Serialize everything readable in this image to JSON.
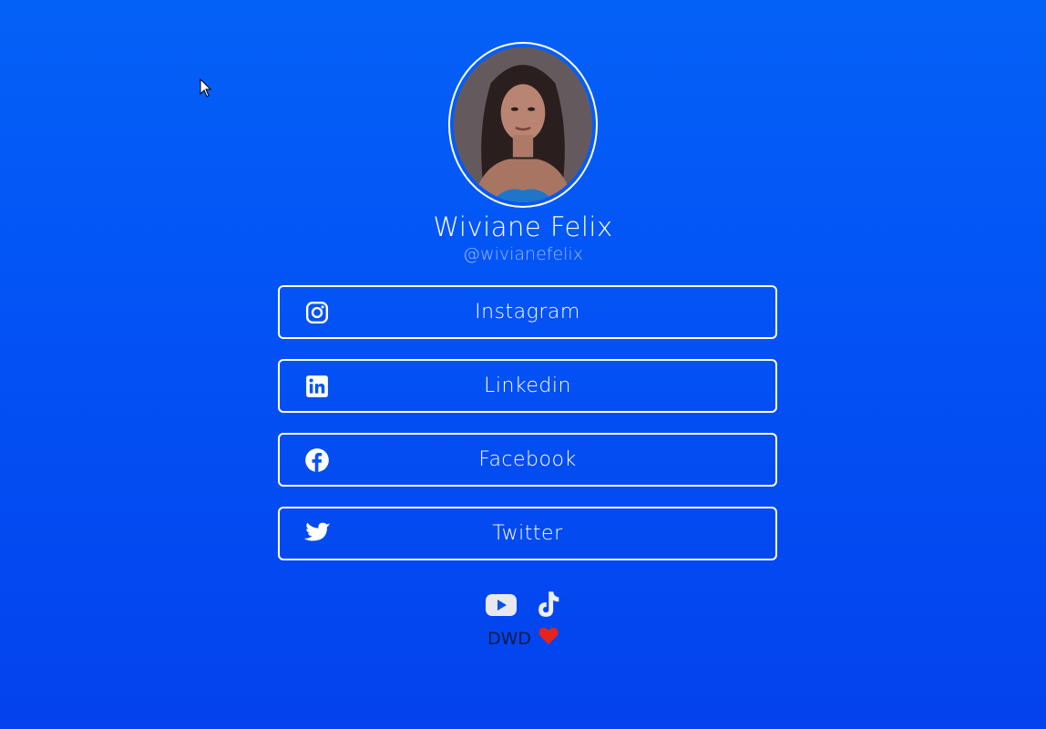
{
  "profile": {
    "name": "Wiviane Felix",
    "handle": "@wivianefelix"
  },
  "links": [
    {
      "label": "Instagram",
      "icon": "instagram-icon"
    },
    {
      "label": "Linkedin",
      "icon": "linkedin-icon"
    },
    {
      "label": "Facebook",
      "icon": "facebook-icon"
    },
    {
      "label": "Twitter",
      "icon": "twitter-icon"
    }
  ],
  "footer": {
    "icons": [
      "youtube-icon",
      "tiktok-icon"
    ],
    "credit": "DWD",
    "credit_icon": "heart-icon"
  },
  "colors": {
    "background": "#0352f5",
    "button_border": "#ffffff",
    "handle": "#9ab8ff",
    "heart": "#e8231b"
  }
}
